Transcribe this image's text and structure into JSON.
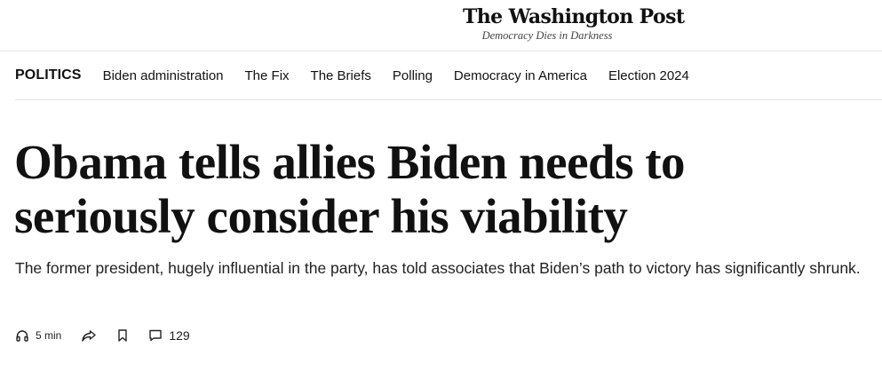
{
  "masthead": {
    "logo_text": "The Washington Post",
    "tagline": "Democracy Dies in Darkness"
  },
  "nav": {
    "section": "POLITICS",
    "links": [
      "Biden administration",
      "The Fix",
      "The Briefs",
      "Polling",
      "Democracy in America",
      "Election 2024"
    ]
  },
  "article": {
    "headline": "Obama tells allies Biden needs to seriously consider his viability",
    "dek": "The former president, hugely influential in the party, has told associates that Biden’s path to victory has significantly shrunk."
  },
  "actions": {
    "listen_label": "5 min",
    "comments_count": "129",
    "icons": {
      "listen": "headphones-icon",
      "share": "share-icon",
      "save": "bookmark-icon",
      "comments": "comment-icon"
    }
  }
}
